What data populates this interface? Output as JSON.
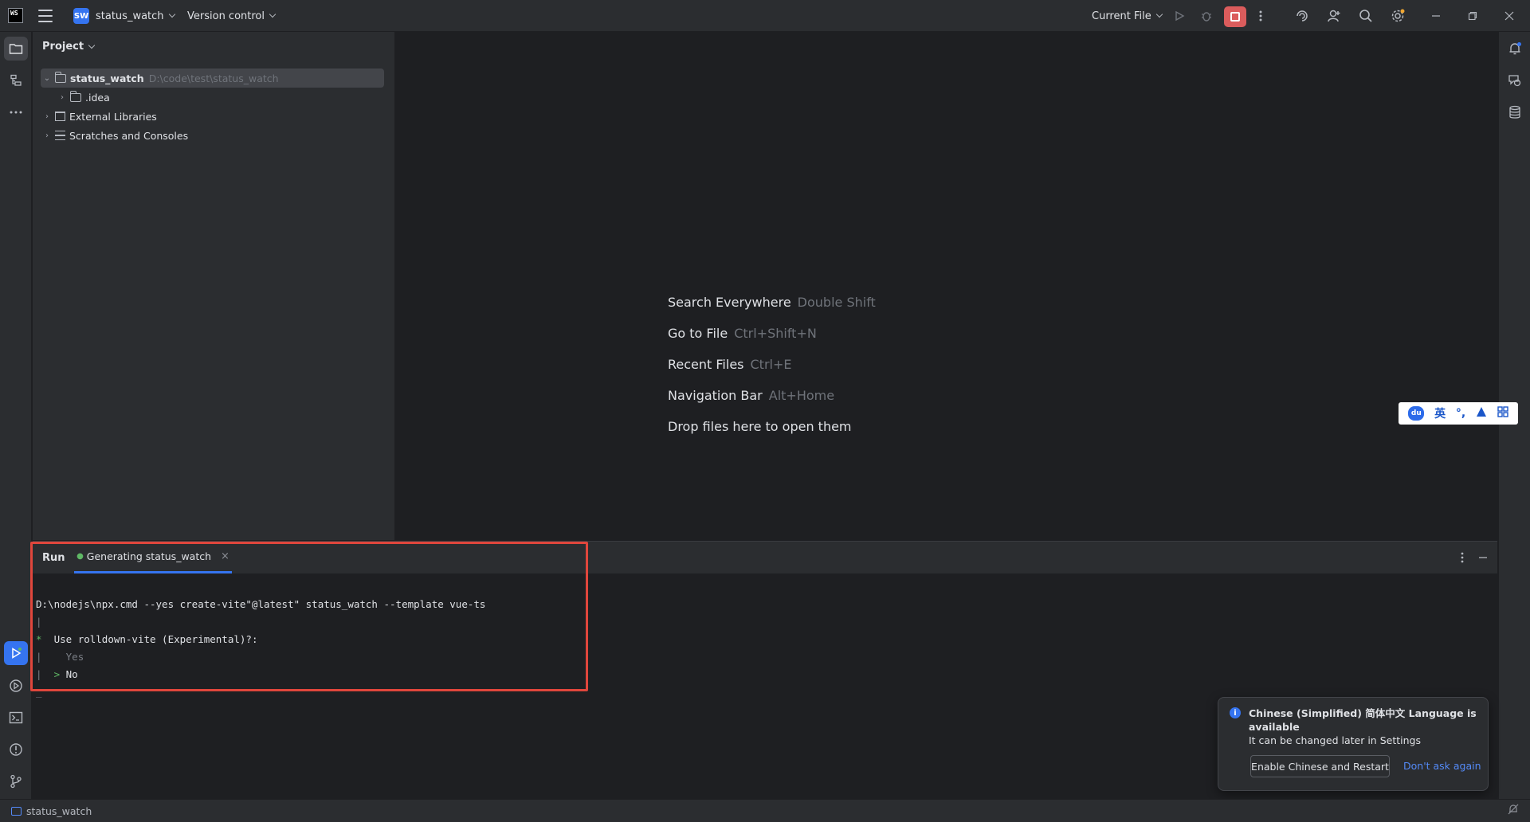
{
  "titlebar": {
    "app_logo": "WS",
    "project_badge": "SW",
    "project_name": "status_watch",
    "vcs_label": "Version control",
    "run_config": "Current File",
    "icons": [
      "hamburger-icon",
      "run-icon",
      "debug-icon",
      "stop-icon",
      "more-icon",
      "ai-assistant-icon",
      "add-user-icon",
      "search-icon",
      "settings-icon",
      "minimize-icon",
      "restore-icon",
      "close-icon"
    ]
  },
  "left_strip": {
    "icons": [
      "project-folder-icon",
      "structure-icon",
      "more-tools-icon",
      "run-tool-icon",
      "services-icon",
      "terminal-icon",
      "problems-icon",
      "git-icon"
    ]
  },
  "right_strip": {
    "icons": [
      "notifications-icon",
      "ai-chat-icon",
      "database-icon"
    ]
  },
  "project_panel": {
    "title": "Project",
    "tree": [
      {
        "label": "status_watch",
        "path": "D:\\code\\test\\status_watch"
      },
      {
        "label": ".idea"
      },
      {
        "label": "External Libraries"
      },
      {
        "label": "Scratches and Consoles"
      }
    ]
  },
  "editor_hints": [
    {
      "label": "Search Everywhere",
      "shortcut": "Double Shift"
    },
    {
      "label": "Go to File",
      "shortcut": "Ctrl+Shift+N"
    },
    {
      "label": "Recent Files",
      "shortcut": "Ctrl+E"
    },
    {
      "label": "Navigation Bar",
      "shortcut": "Alt+Home"
    },
    {
      "label": "Drop files here to open them",
      "shortcut": ""
    }
  ],
  "ime": {
    "lang": "英",
    "punct": "°,",
    "logo": "du"
  },
  "run_window": {
    "title": "Run",
    "tab_label": "Generating status_watch",
    "command": "D:\\nodejs\\npx.cmd --yes create-vite\"@latest\" status_watch --template vue-ts",
    "question": "Use rolldown-vite (Experimental)?:",
    "option_yes": "Yes",
    "option_no": "No",
    "bullet": "*",
    "pipe": "|",
    "pointer": ">",
    "cursor": "_"
  },
  "notification": {
    "title": "Chinese (Simplified) 简体中文 Language is available",
    "body": "It can be changed later in Settings",
    "primary_button": "Enable Chinese and Restart",
    "secondary_link": "Don't ask again",
    "accent_color": "#3574f0"
  },
  "statusbar": {
    "project": "status_watch"
  },
  "colors": {
    "background": "#1e1f22",
    "panel": "#2b2d30",
    "accent": "#3574f0",
    "stop": "#db5c5c",
    "highlight_border": "#e0463c",
    "console_green": "#5fb865"
  }
}
